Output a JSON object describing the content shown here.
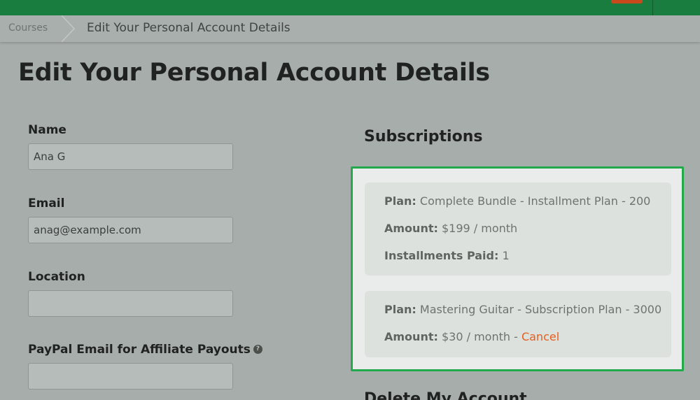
{
  "breadcrumb": {
    "root": "Courses",
    "current": "Edit Your Personal Account Details"
  },
  "page": {
    "title": "Edit Your Personal Account Details"
  },
  "form": {
    "name": {
      "label": "Name",
      "value": "Ana G"
    },
    "email": {
      "label": "Email",
      "value": "anag@example.com"
    },
    "location": {
      "label": "Location",
      "value": ""
    },
    "paypal": {
      "label": "PayPal Email for Affiliate Payouts",
      "value": "",
      "help_icon": "?"
    }
  },
  "subscriptions": {
    "heading": "Subscriptions",
    "items": [
      {
        "plan_label": "Plan:",
        "plan": "Complete Bundle - Installment Plan - 200",
        "amount_label": "Amount:",
        "amount": "$199 / month",
        "installments_label": "Installments Paid:",
        "installments": "1"
      },
      {
        "plan_label": "Plan:",
        "plan": "Mastering Guitar - Subscription Plan - 3000",
        "amount_label": "Amount:",
        "amount": "$30 / month -",
        "cancel": "Cancel"
      }
    ]
  },
  "delete_account": {
    "heading": "Delete My Account"
  },
  "colors": {
    "topbar": "#187d3f",
    "highlight_border": "#22a94b",
    "cancel_link": "#e55f1e"
  }
}
